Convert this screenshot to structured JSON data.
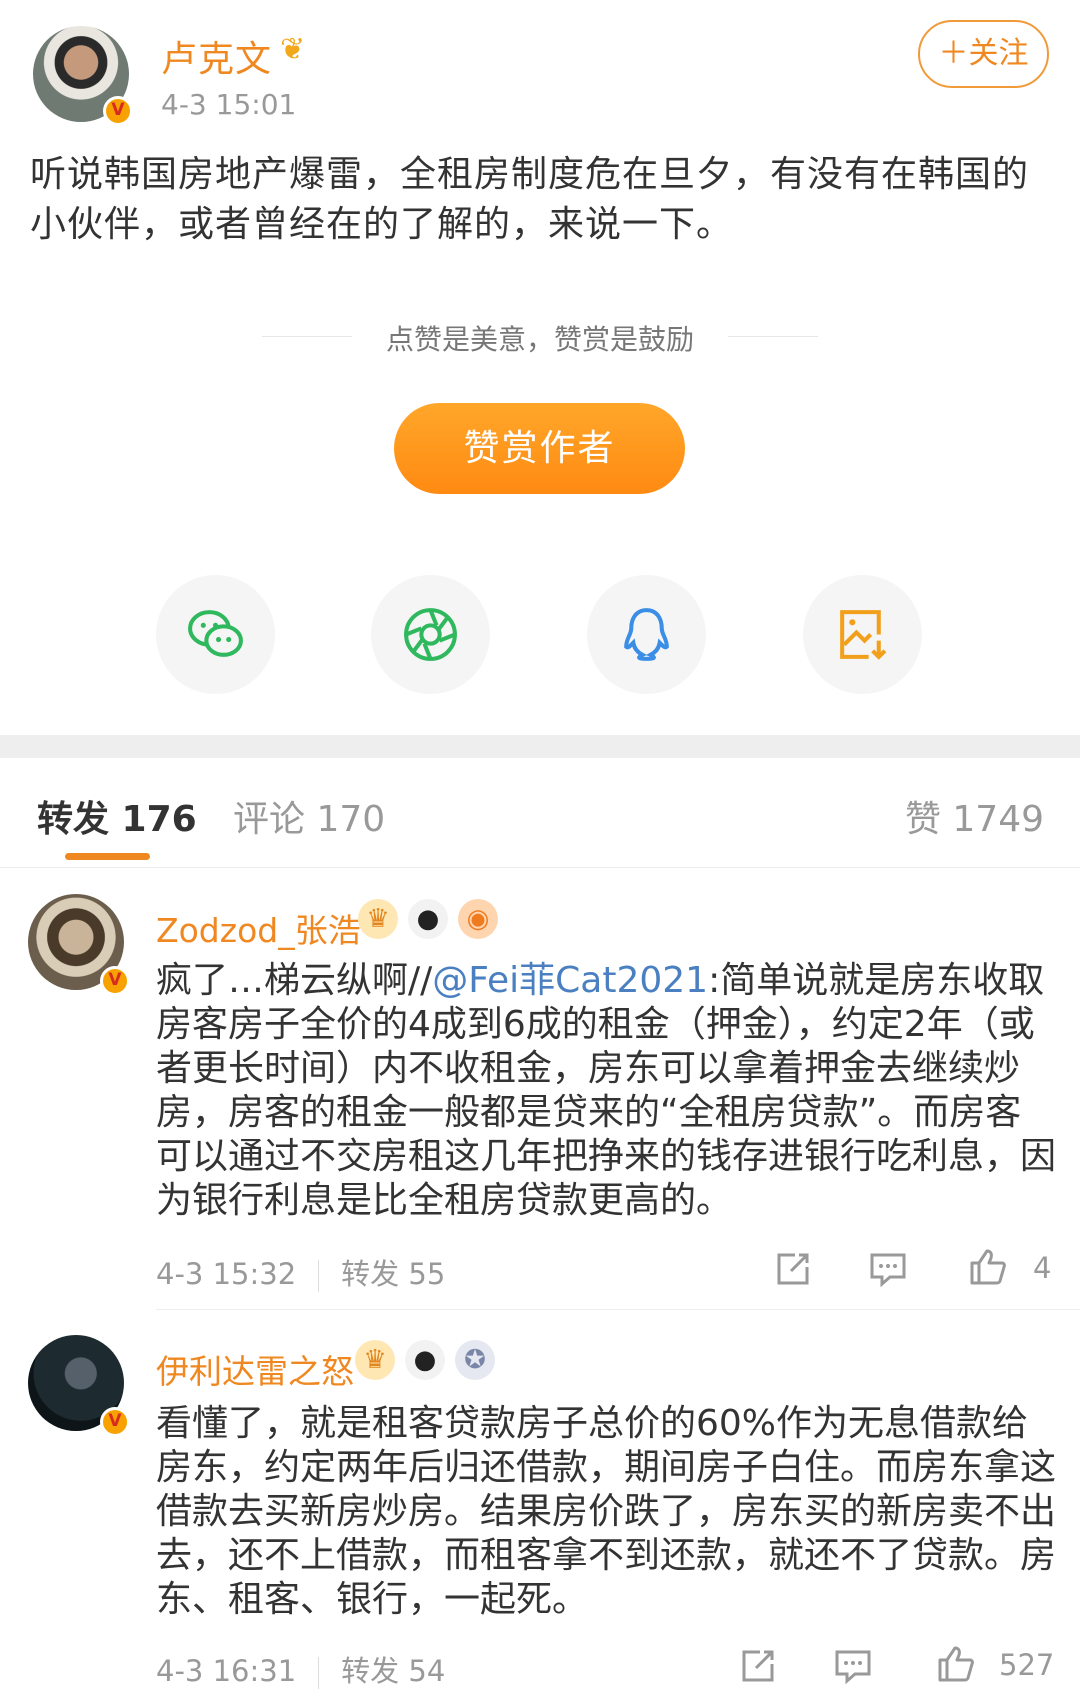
{
  "post": {
    "author": "卢克文",
    "verified_mark": "V",
    "time": "4-3 15:01",
    "follow_label": "＋关注",
    "text": "听说韩国房地产爆雷，全租房制度危在旦夕，有没有在韩国的小伙伴，或者曾经在的了解的，来说一下。",
    "reward_slogan": "点赞是美意，赞赏是鼓励",
    "reward_button": "赞赏作者",
    "share_icons": [
      "wechat-icon",
      "moments-icon",
      "qq-icon",
      "save-image-icon"
    ]
  },
  "tabs": {
    "repost": "转发 176",
    "comment": "评论 170",
    "like": "赞 1749"
  },
  "reposts": [
    {
      "name": "Zodzod_张浩",
      "verified_mark": "V",
      "text_before": "疯了…梯云纵啊//",
      "mention": "@Fei菲Cat2021",
      "text_after": ":简单说就是房东收取房客房子全价的4成到6成的租金（押金），约定2年（或者更长时间）内不收租金，房东可以拿着押金去继续炒房，房客的租金一般都是贷来的“全租房贷款”。而房客可以通过不交房租这几年把挣来的钱存进银行吃利息，因为银行利息是比全租房贷款更高的。",
      "time": "4-3 15:32",
      "repost": "转发 55",
      "likes": "4"
    },
    {
      "name": "伊利达雷之怒",
      "verified_mark": "V",
      "text": "看懂了，就是租客贷款房子总价的60%作为无息借款给房东，约定两年后归还借款，期间房子白住。而房东拿这借款去买新房炒房。结果房价跌了，房东买的新房卖不出去，还不上借款，而租客拿不到还款，就还不了贷款。房东、租客、银行，一起死。",
      "time": "4-3 16:31",
      "repost": "转发 54",
      "likes": "527"
    }
  ],
  "colors": {
    "accent": "#f08822",
    "link": "#4a7fc1"
  }
}
